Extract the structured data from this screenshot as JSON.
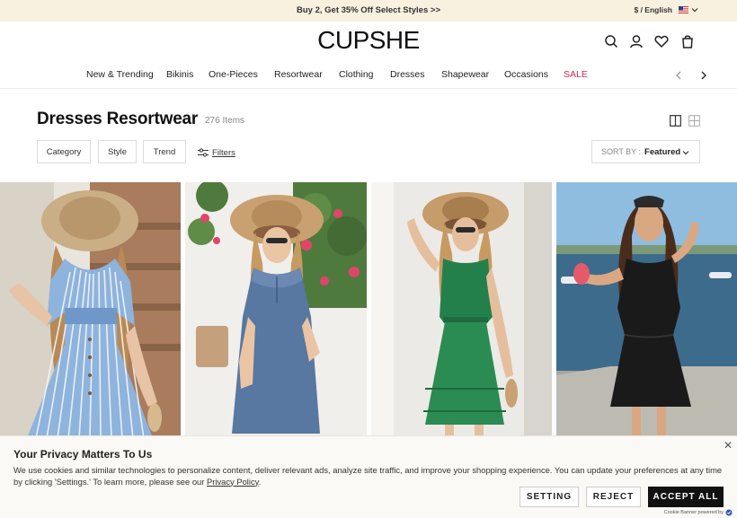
{
  "announcement": {
    "text": "Buy 2, Get 35% Off Select Styles >>"
  },
  "locale": {
    "label": "$ / English"
  },
  "header": {
    "logo": "CUPSHE"
  },
  "nav": {
    "items": [
      {
        "label": "New & Trending"
      },
      {
        "label": "Bikinis"
      },
      {
        "label": "One-Pieces"
      },
      {
        "label": "Resortwear"
      },
      {
        "label": "Clothing"
      },
      {
        "label": "Dresses"
      },
      {
        "label": "Shapewear"
      },
      {
        "label": "Occasions"
      },
      {
        "label": "SALE"
      }
    ]
  },
  "page": {
    "title": "Dresses Resortwear",
    "count": "276 Items"
  },
  "filters": {
    "category": "Category",
    "style": "Style",
    "trend": "Trend",
    "filters_link": "Filters",
    "sort_label": "SORT BY :",
    "sort_value": "Featured"
  },
  "products": [
    {
      "name": "blue-striped-dress"
    },
    {
      "name": "denim-dress"
    },
    {
      "name": "green-dress"
    },
    {
      "name": "black-dress"
    }
  ],
  "cookie": {
    "title": "Your Privacy Matters To Us",
    "body": "We use cookies and similar technologies to personalize content, deliver relevant ads, analyze site traffic, and improve your shopping experience. You can update your preferences at any time by clicking 'Settings.' To learn more, please see our",
    "policy_link": "Privacy Policy",
    "setting": "SETTING",
    "reject": "REJECT",
    "accept": "ACCEPT ALL",
    "powered_by": "Cookie Banner powered by"
  },
  "colors": {
    "sale": "#d6244e",
    "announce_bg": "#f8f1df",
    "accept_bg": "#111111"
  }
}
